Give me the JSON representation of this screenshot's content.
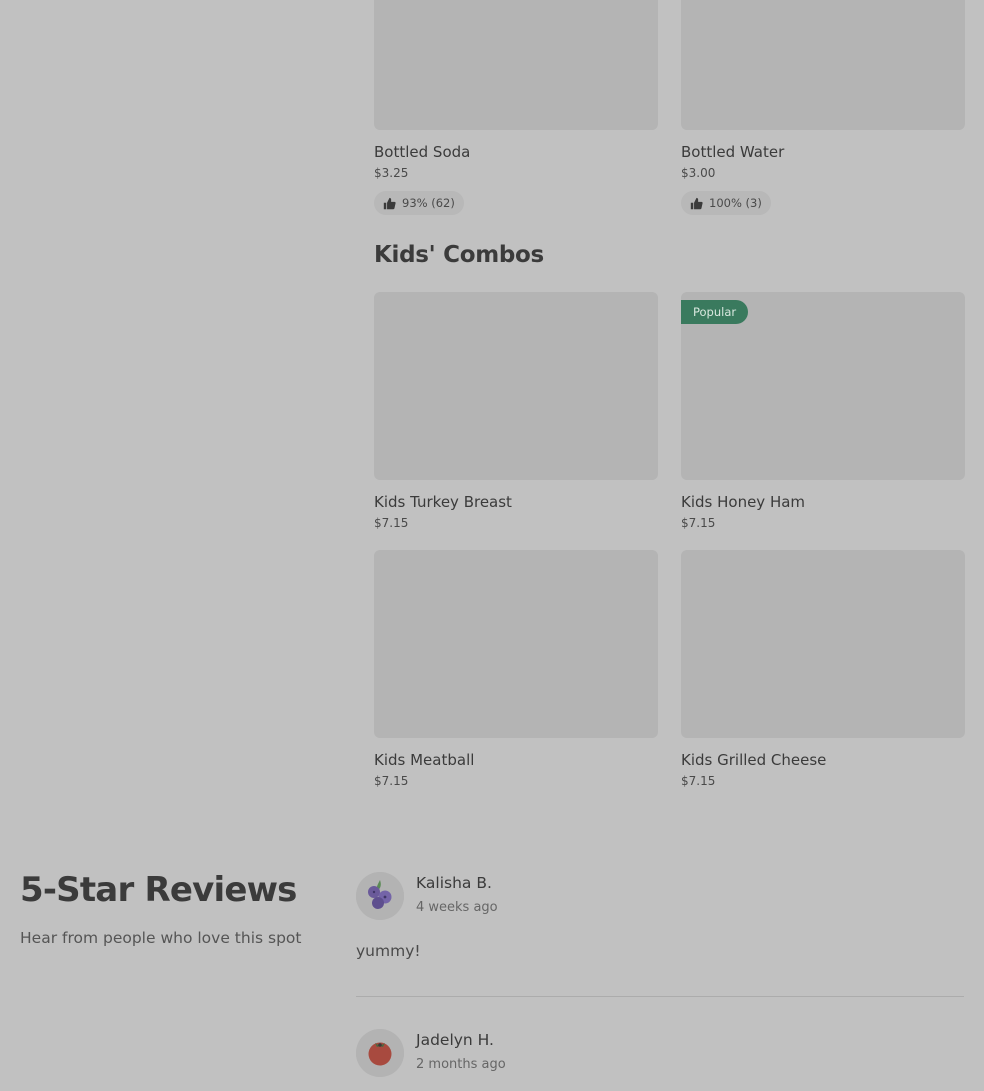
{
  "drinks": [
    {
      "name": "Bottled Soda",
      "price": "$3.25",
      "rating": "93% (62)"
    },
    {
      "name": "Bottled Water",
      "price": "$3.00",
      "rating": "100% (3)"
    }
  ],
  "kids_combos": {
    "title": "Kids' Combos",
    "items": [
      {
        "name": "Kids Turkey Breast",
        "price": "$7.15",
        "badge": ""
      },
      {
        "name": "Kids Honey Ham",
        "price": "$7.15",
        "badge": "Popular"
      },
      {
        "name": "Kids Meatball",
        "price": "$7.15",
        "badge": ""
      },
      {
        "name": "Kids Grilled Cheese",
        "price": "$7.15",
        "badge": ""
      }
    ]
  },
  "reviews": {
    "title": "5-Star Reviews",
    "subtitle": "Hear from people who love this spot",
    "items": [
      {
        "name": "Kalisha B.",
        "time": "4 weeks ago",
        "text": "yummy!",
        "avatar": "blueberry-icon"
      },
      {
        "name": "Jadelyn H.",
        "time": "2 months ago",
        "text": "",
        "avatar": "tomato-icon"
      }
    ]
  },
  "colors": {
    "background": "#c1c1c1",
    "placeholder": "#b4b4b4",
    "badge": "#3a7a5e"
  }
}
